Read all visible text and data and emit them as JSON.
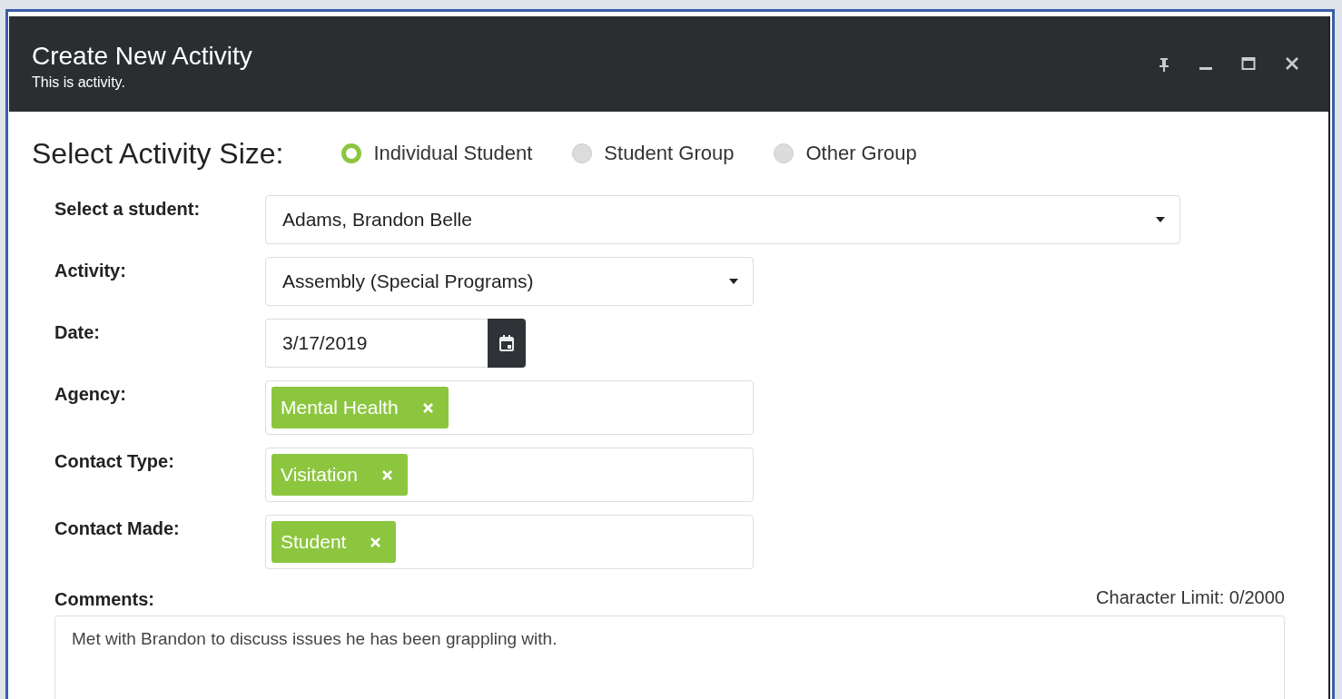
{
  "window": {
    "title": "Create New Activity",
    "subtitle": "This is activity."
  },
  "window_controls": [
    {
      "kind": "pin"
    },
    {
      "kind": "minimize"
    },
    {
      "kind": "maximize"
    },
    {
      "kind": "close"
    }
  ],
  "activity_size": {
    "label": "Select Activity Size:",
    "options": [
      {
        "label": "Individual Student",
        "selected": true
      },
      {
        "label": "Student Group",
        "selected": false
      },
      {
        "label": "Other Group",
        "selected": false
      }
    ]
  },
  "fields": [
    {
      "kind": "select",
      "label": "Select a student:",
      "value": "Adams, Brandon Belle",
      "wide": true
    },
    {
      "kind": "select",
      "label": "Activity:",
      "value": "Assembly (Special Programs)",
      "wide": false
    },
    {
      "kind": "date",
      "label": "Date:",
      "value": "3/17/2019"
    },
    {
      "kind": "tags",
      "label": "Agency:",
      "tags": [
        "Mental Health"
      ]
    },
    {
      "kind": "tags",
      "label": "Contact Type:",
      "tags": [
        "Visitation"
      ]
    },
    {
      "kind": "tags",
      "label": "Contact Made:",
      "tags": [
        "Student"
      ]
    }
  ],
  "comments": {
    "label": "Comments:",
    "limit": "Character Limit: 0/2000",
    "value": "Met with Brandon to discuss issues he has been grappling with."
  }
}
